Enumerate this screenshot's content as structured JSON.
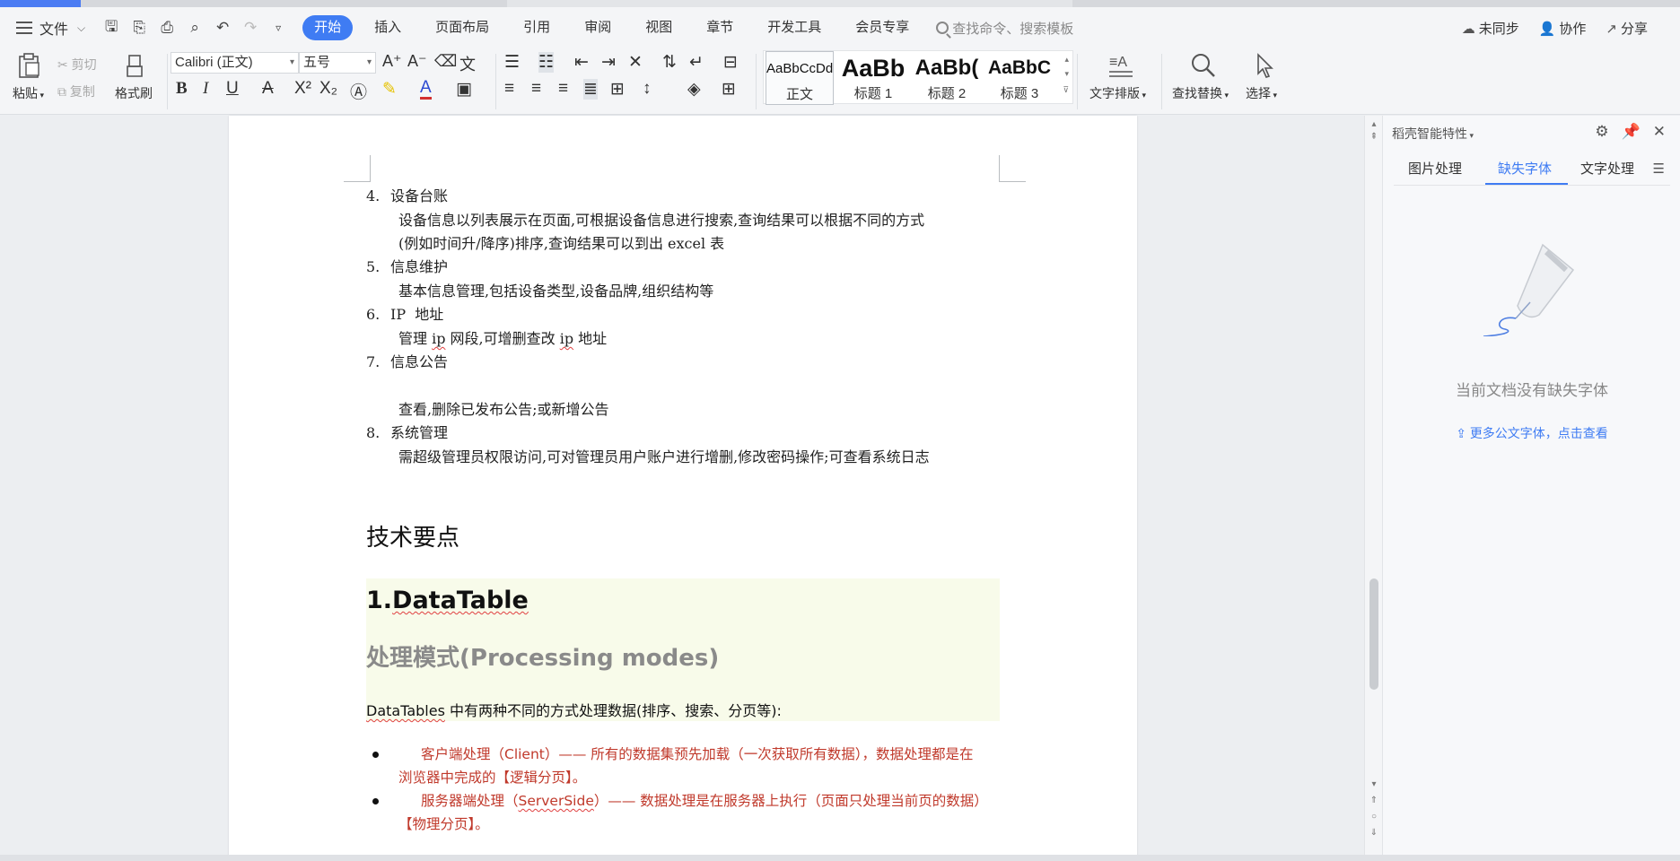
{
  "menubar": {
    "file": "文件",
    "tabs": [
      "开始",
      "插入",
      "页面布局",
      "引用",
      "审阅",
      "视图",
      "章节",
      "开发工具",
      "会员专享"
    ],
    "search_placeholder": "查找命令、搜索模板",
    "sync": "未同步",
    "collab": "协作",
    "share": "分享"
  },
  "ribbon": {
    "paste": "粘贴",
    "cut": "剪切",
    "copy": "复制",
    "format_painter": "格式刷",
    "font_name": "Calibri (正文)",
    "font_size": "五号",
    "bold": "B",
    "italic": "I",
    "underline": "U",
    "styles": [
      {
        "sample": "AaBbCcDd",
        "name": "正文"
      },
      {
        "sample": "AaBb",
        "name": "标题 1"
      },
      {
        "sample": "AaBb(",
        "name": "标题 2"
      },
      {
        "sample": "AaBbC",
        "name": "标题 3"
      }
    ],
    "text_layout": "文字排版",
    "find_replace": "查找替换",
    "select": "选择"
  },
  "document": {
    "items": [
      {
        "num": "4.",
        "title": "设备台账",
        "desc": [
          "设备信息以列表展示在页面,可根据设备信息进行搜索,查询结果可以根据不同的方式",
          "(例如时间升/降序)排序,查询结果可以到出 excel 表"
        ]
      },
      {
        "num": "5.",
        "title": "信息维护",
        "desc": [
          "基本信息管理,包括设备类型,设备品牌,组织结构等"
        ]
      },
      {
        "num": "6.",
        "title": "IP  地址",
        "desc_parts": [
          "管理 ",
          "ip",
          " 网段,可增删查改 ",
          "ip",
          " 地址"
        ]
      },
      {
        "num": "7.",
        "title": "信息公告",
        "desc": [
          "查看,删除已发布公告;或新增公告"
        ]
      },
      {
        "num": "8.",
        "title": "系统管理",
        "desc": [
          "需超级管理员权限访问,可对管理员用户账户进行增删,修改密码操作;可查看系统日志"
        ]
      }
    ],
    "heading_tech": "技术要点",
    "heading_dt_num": "1.",
    "heading_dt": "DataTable",
    "heading_proc": "处理模式(Processing modes)",
    "para_dt_word": "DataTables",
    "para_dt_rest": " 中有两种不同的方式处理数据(排序、搜索、分页等):",
    "bullet1_line1": "客户端处理（Client）——  所有的数据集预先加载（一次获取所有数据），数据处理都是在",
    "bullet1_line2": "浏览器中完成的【逻辑分页】。",
    "bullet2_pre": "服务器端处理（",
    "bullet2_word": "ServerSide",
    "bullet2_post": "）——  数据处理是在服务器上执行（页面只处理当前页的数据）",
    "bullet2_line2": "【物理分页】。"
  },
  "panel": {
    "title": "稻壳智能特性",
    "tabs": [
      "图片处理",
      "缺失字体",
      "文字处理"
    ],
    "empty_message": "当前文档没有缺失字体",
    "more_link": "更多公文字体，点击查看"
  },
  "colors": {
    "accent": "#3f7cf3",
    "bullet_red": "#c0392b",
    "highlight_bg": "#f8fbea"
  }
}
